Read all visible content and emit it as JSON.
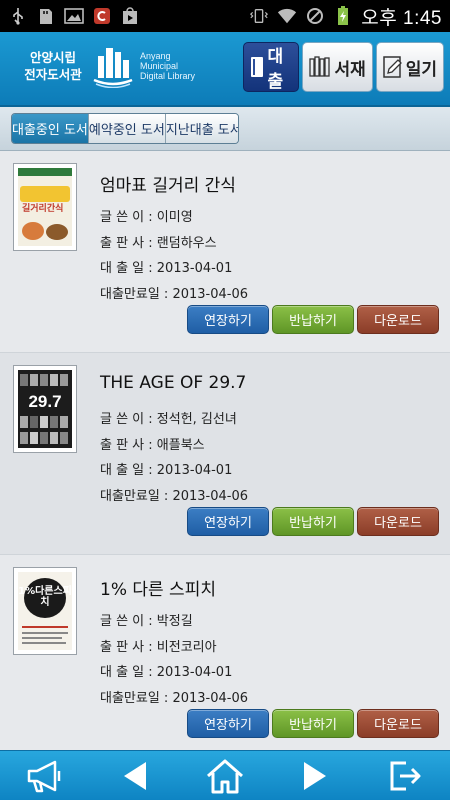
{
  "status_bar": {
    "time": "오후 1:45",
    "left_icons": [
      "usb-icon",
      "sd-card-icon",
      "image-icon",
      "app-c-icon",
      "play-store-icon"
    ],
    "right_icons": [
      "vibrate-icon",
      "wifi-icon",
      "no-sim-icon",
      "battery-charging-icon"
    ]
  },
  "header": {
    "logo_korean": [
      "안양시립",
      "전자도서관"
    ],
    "logo_english": [
      "Anyang",
      "Municipal",
      "Digital Library"
    ],
    "nav": [
      {
        "label": "대출",
        "active": true
      },
      {
        "label": "서재",
        "active": false
      },
      {
        "label": "일기",
        "active": false
      }
    ]
  },
  "tabs": [
    {
      "label": "대출중인 도서",
      "active": true
    },
    {
      "label": "예약중인 도서",
      "active": false
    },
    {
      "label": "지난대출 도서",
      "active": false
    }
  ],
  "books": [
    {
      "title": "엄마표 길거리 간식",
      "author_row": "글 쓴 이 : 이미영",
      "publisher_row": "출 판 사 : 랜덤하우스",
      "loan_date_row": "대 출 일 : 2013-04-01",
      "due_date_row": "대출만료일 : 2013-04-06",
      "cover_text": "길거리간식"
    },
    {
      "title": "THE AGE OF 29.7",
      "author_row": "글 쓴 이 : 정석헌, 김선녀",
      "publisher_row": "출 판 사 : 애플북스",
      "loan_date_row": "대 출 일 : 2013-04-01",
      "due_date_row": "대출만료일 : 2013-04-06",
      "cover_text": "29.7"
    },
    {
      "title": "1% 다른 스피치",
      "author_row": "글 쓴 이 : 박정길",
      "publisher_row": "출 판 사 : 비전코리아",
      "loan_date_row": "대 출 일 : 2013-04-01",
      "due_date_row": "대출만료일 : 2013-04-06",
      "cover_text": "1%다른스피치"
    }
  ],
  "actions": {
    "extend": "연장하기",
    "return": "반납하기",
    "download": "다운로드"
  },
  "bottom_bar": [
    "megaphone-icon",
    "back-arrow-icon",
    "home-icon",
    "forward-arrow-icon",
    "logout-icon"
  ],
  "colors": {
    "header_blue": "#1b99d2",
    "active_nav": "#13337a",
    "extend_button": "#2a6db5",
    "return_button": "#74ab35",
    "download_button": "#9c4b34"
  }
}
